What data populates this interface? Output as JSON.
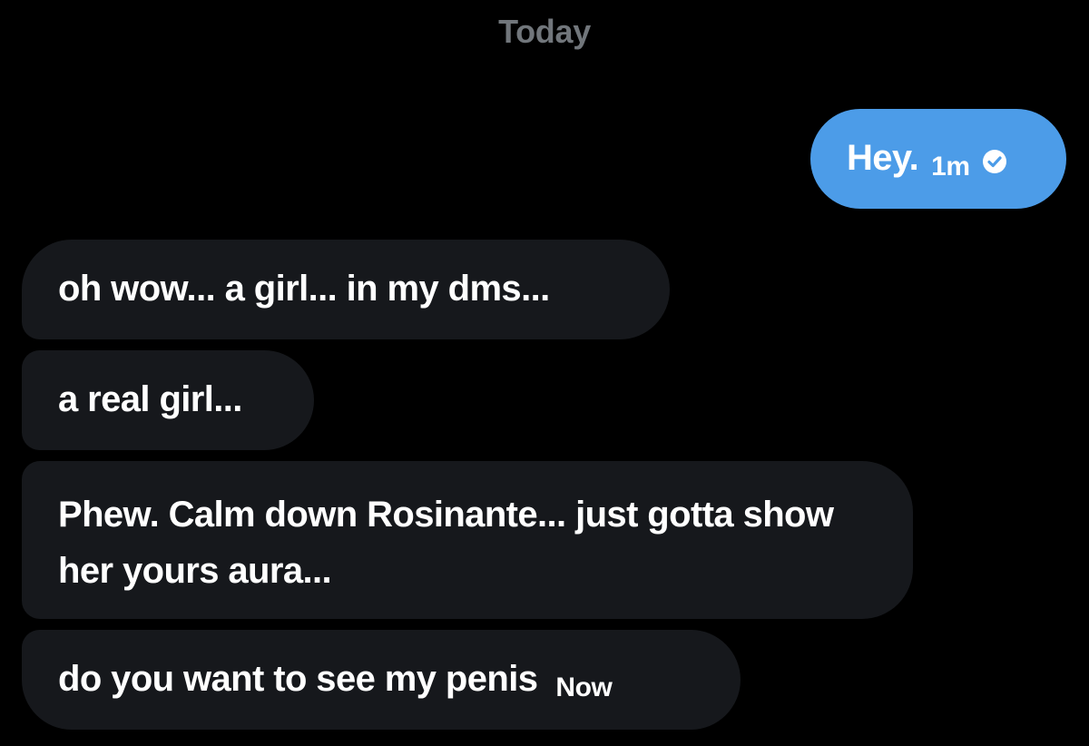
{
  "conversation": {
    "day_separator": "Today",
    "messages": [
      {
        "direction": "sent",
        "text": "Hey.",
        "time": "1m",
        "status_icon": "seen-check-icon"
      },
      {
        "direction": "received",
        "text": "oh wow... a girl... in my dms..."
      },
      {
        "direction": "received",
        "text": "a real girl..."
      },
      {
        "direction": "received",
        "text": "Phew. Calm down Rosinante... just gotta show her yours aura..."
      },
      {
        "direction": "received",
        "text": "do you want to see my penis",
        "time": "Now"
      }
    ]
  },
  "colors": {
    "background": "#000000",
    "sent_bubble": "#4c9ce8",
    "received_bubble": "#16181c",
    "secondary_text": "#71767b"
  }
}
